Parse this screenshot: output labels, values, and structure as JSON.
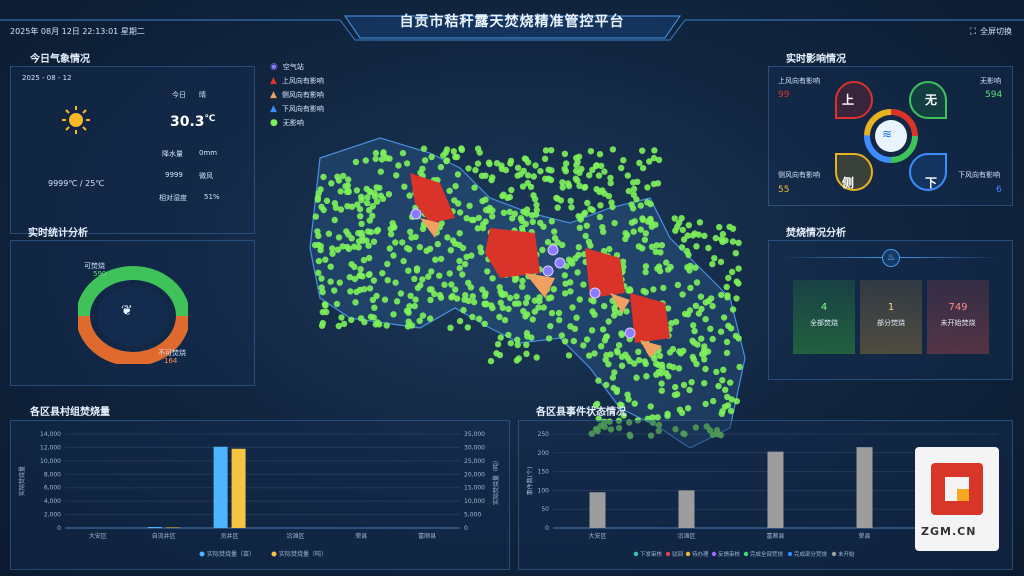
{
  "header": {
    "title": "自贡市秸秆露天焚烧精准管控平台",
    "datetime": "2025年 08月 12日 22:13:01  星期二",
    "fullscreen_label": "全屏切换",
    "fullscreen_icon": "expand-icon"
  },
  "weather": {
    "title": "今日气象情况",
    "date": "2025 - 08 - 12",
    "today_label": "今日",
    "condition": "晴",
    "temperature": "30.3",
    "temperature_unit": "℃",
    "precip_label": "降水量",
    "precip_value": "0mm",
    "wind_value": "9999",
    "wind_label": "微风",
    "humidity_label": "相对湿度",
    "humidity_value": "51%",
    "temp_range": "9999℃ / 25℃",
    "icon": "sun-icon"
  },
  "realtime_stats": {
    "title": "实时统计分析",
    "burnable_label": "可焚烧",
    "burnable_value": "590",
    "non_burnable_label": "不可焚烧",
    "non_burnable_value": "164"
  },
  "map_legend": [
    {
      "label": "空气站",
      "color": "#8a7bff",
      "icon": "station-pin-icon"
    },
    {
      "label": "上风向有影响",
      "color": "#e0342a",
      "icon": "triangle-icon"
    },
    {
      "label": "侧风向有影响",
      "color": "#f0a060",
      "icon": "triangle-icon"
    },
    {
      "label": "下风向有影响",
      "color": "#3f8cff",
      "icon": "triangle-icon"
    },
    {
      "label": "无影响",
      "color": "#7ef25a",
      "icon": "dot-icon"
    }
  ],
  "impact": {
    "title": "实时影响情况",
    "upwind_label": "上风向有影响",
    "upwind_value": "99",
    "upwind_char": "上",
    "none_label": "无影响",
    "none_value": "594",
    "none_char": "无",
    "side_label": "侧风向有影响",
    "side_value": "55",
    "side_char": "侧",
    "down_label": "下风向有影响",
    "down_value": "6",
    "down_char": "下"
  },
  "burn_analysis": {
    "title": "焚烧情况分析",
    "cards": [
      {
        "value": "4",
        "label": "全部焚烧",
        "color": "#7dff8a"
      },
      {
        "value": "1",
        "label": "部分焚烧",
        "color": "#ffd080"
      },
      {
        "value": "749",
        "label": "未开始焚烧",
        "color": "#ff8a8a"
      }
    ]
  },
  "county_burn_chart": {
    "title": "各区县村组焚烧量",
    "chart_data": {
      "type": "bar",
      "categories": [
        "大安区",
        "自流井区",
        "贡井区",
        "沿滩区",
        "荣县",
        "富顺县"
      ],
      "series": [
        {
          "name": "实际焚烧量（亩）",
          "values": [
            0,
            150,
            12100,
            0,
            0,
            0
          ],
          "color": "#4fb3ff"
        },
        {
          "name": "实际焚烧量（吨）",
          "values": [
            0,
            200,
            29500,
            0,
            0,
            0
          ],
          "color": "#f5c542"
        }
      ],
      "ylabel": "实际焚烧量",
      "y2label": "实际焚烧量（吨）",
      "ylim": [
        0,
        14000
      ],
      "y2lim": [
        0,
        35000
      ],
      "yticks": [
        "14,000",
        "12,000",
        "10,000",
        "8,000",
        "6,000",
        "4,000",
        "2,000",
        "0"
      ],
      "y2ticks": [
        "35,000",
        "30,000",
        "25,000",
        "20,000",
        "15,000",
        "10,000",
        "5,000",
        "0"
      ],
      "legend": "bottom"
    }
  },
  "county_event_chart": {
    "title": "各区县事件状态情况",
    "chart_data": {
      "type": "bar",
      "categories": [
        "大安区",
        "沿滩区",
        "富顺县",
        "荣县",
        "自流井区"
      ],
      "values": [
        95,
        100,
        203,
        215,
        95
      ],
      "ylabel": "事件数(个)",
      "ylim": [
        0,
        250
      ],
      "yticks": [
        "250",
        "200",
        "150",
        "100",
        "50",
        "0"
      ],
      "legend_items": [
        {
          "label": "下发审核",
          "color": "#3fc1c9"
        },
        {
          "label": "驳回",
          "color": "#e04545"
        },
        {
          "label": "待办理",
          "color": "#f5b82e"
        },
        {
          "label": "反馈审核",
          "color": "#9b6bff"
        },
        {
          "label": "完成全部焚烧",
          "color": "#3ee07a"
        },
        {
          "label": "完成部分焚烧",
          "color": "#2f8cff"
        },
        {
          "label": "未开始",
          "color": "#a0a0a0"
        }
      ],
      "legend": "bottom"
    }
  },
  "watermark": {
    "text": "ZGM.CN"
  }
}
